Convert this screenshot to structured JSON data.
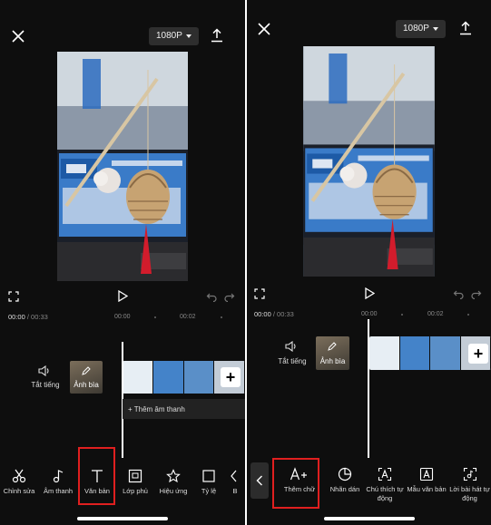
{
  "left": {
    "resolution": "1080P",
    "timecode_current": "00:00",
    "timecode_total": "/ 00:33",
    "ruler": [
      "00:00",
      "00:02"
    ],
    "mute_label": "Tắt tiếng",
    "cover_label": "Ảnh bìa",
    "add_audio_label": "+ Thêm âm thanh",
    "toolbar": [
      {
        "label": "Chỉnh sửa",
        "icon": "scissors-icon"
      },
      {
        "label": "Âm thanh",
        "icon": "music-note-icon"
      },
      {
        "label": "Văn bản",
        "icon": "text-icon",
        "highlighted": true
      },
      {
        "label": "Lớp phủ",
        "icon": "overlay-icon"
      },
      {
        "label": "Hiệu ứng",
        "icon": "effects-star-icon"
      },
      {
        "label": "Tỷ lệ",
        "icon": "ratio-icon"
      },
      {
        "label": "B",
        "icon": "partial-icon"
      }
    ]
  },
  "right": {
    "resolution": "1080P",
    "timecode_current": "00:00",
    "timecode_total": "/ 00:33",
    "ruler": [
      "00:00",
      "00:02"
    ],
    "mute_label": "Tắt tiếng",
    "cover_label": "Ảnh bìa",
    "toolbar": [
      {
        "label": "Thêm chữ",
        "icon": "add-text-icon",
        "highlighted": true
      },
      {
        "label": "Nhãn dán",
        "icon": "sticker-icon"
      },
      {
        "label": "Chú thích tự động",
        "icon": "auto-caption-icon"
      },
      {
        "label": "Mẫu văn bản",
        "icon": "text-template-icon"
      },
      {
        "label": "Lời bài hát tự động",
        "icon": "auto-lyrics-icon"
      }
    ]
  },
  "colors": {
    "highlight": "#e01f1f",
    "background": "#0e0e0e",
    "button_bg": "#2e2e2e"
  }
}
